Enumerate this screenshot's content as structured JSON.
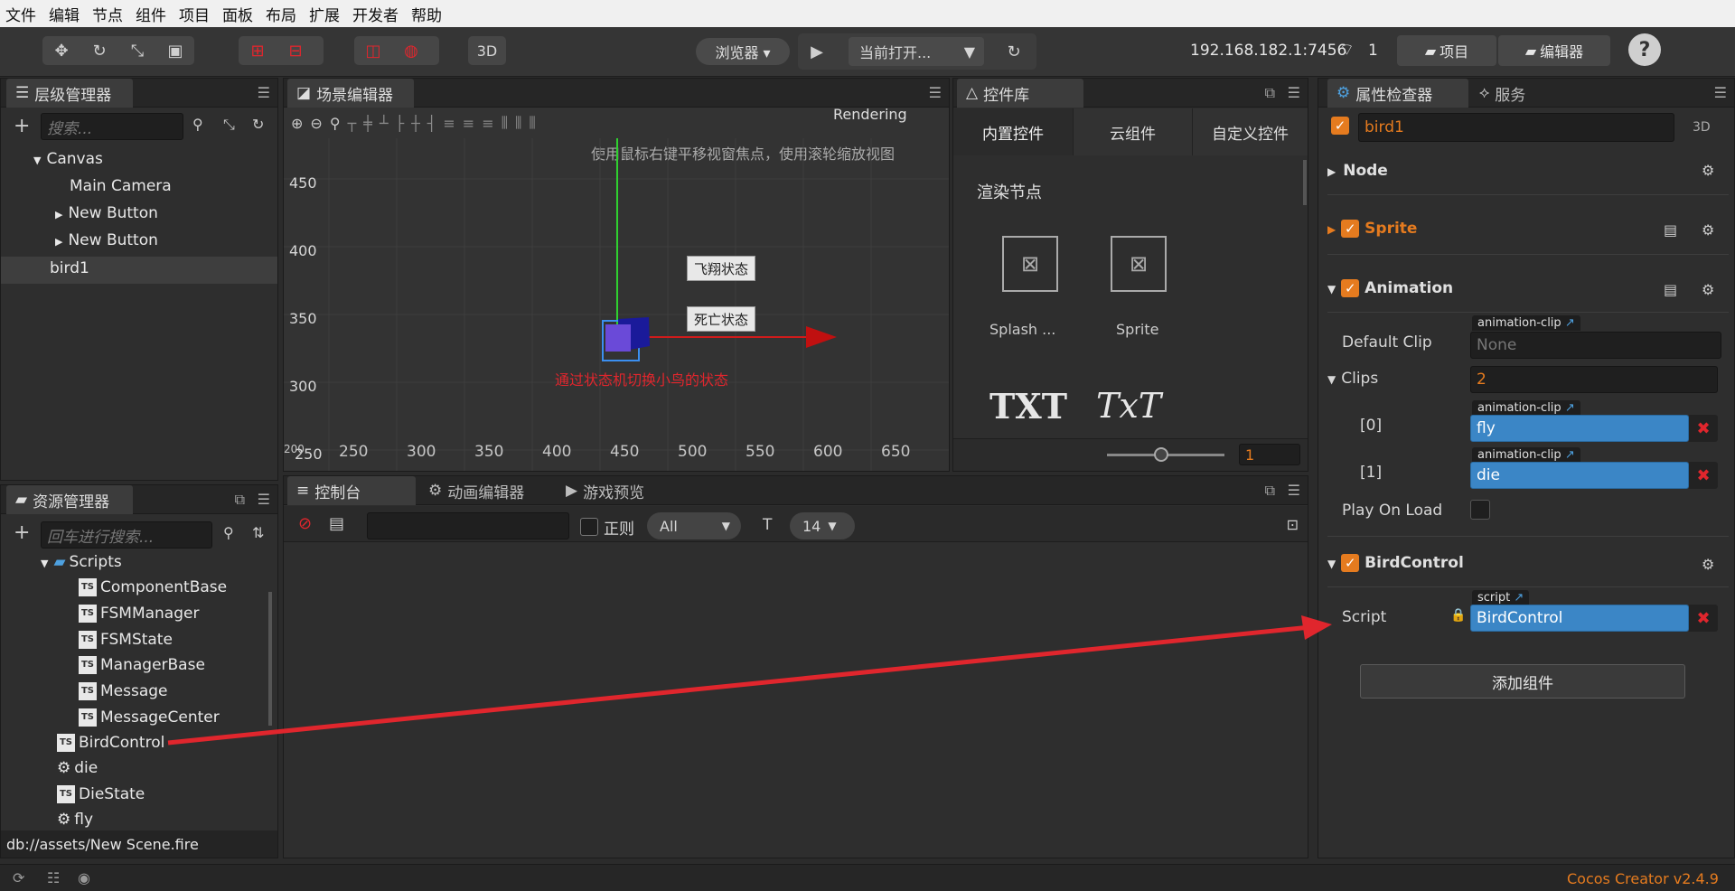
{
  "menu": [
    "文件",
    "编辑",
    "节点",
    "组件",
    "项目",
    "面板",
    "布局",
    "扩展",
    "开发者",
    "帮助"
  ],
  "toolbar": {
    "mode_3d": "3D",
    "browser": "浏览器 ▾",
    "current_open": "当前打开...",
    "ip": "192.168.182.1:7456",
    "conn_count": "1",
    "project": "项目",
    "editor": "编辑器",
    "help": "?"
  },
  "hierarchy": {
    "title": "层级管理器",
    "search_placeholder": "搜索...",
    "items": [
      "Canvas",
      "Main Camera",
      "New Button",
      "New Button",
      "bird1"
    ]
  },
  "scene": {
    "title": "场景编辑器",
    "rendering": "Rendering",
    "hint": "使用鼠标右键平移视窗焦点，使用滚轮缩放视图",
    "y_ticks": [
      "450",
      "400",
      "350",
      "300",
      "250"
    ],
    "x_ticks": [
      "200",
      "250",
      "300",
      "350",
      "400",
      "450",
      "500",
      "550",
      "600",
      "650"
    ],
    "btn_fly": "飞翔状态",
    "btn_die": "死亡状态",
    "caption": "通过状态机切换小鸟的状态"
  },
  "library": {
    "title": "控件库",
    "tabs": [
      "内置控件",
      "云组件",
      "自定义控件"
    ],
    "section": "渲染节点",
    "items": [
      "Splash ...",
      "Sprite"
    ],
    "txt_items": [
      "TXT",
      "TxT"
    ],
    "zoom_value": "1"
  },
  "assets": {
    "title": "资源管理器",
    "search_placeholder": "回车进行搜索...",
    "folder": "Scripts",
    "scripts": [
      "ComponentBase",
      "FSMManager",
      "FSMState",
      "ManagerBase",
      "Message",
      "MessageCenter"
    ],
    "root_items": [
      "BirdControl",
      "die",
      "DieState",
      "fly"
    ],
    "path": "db://assets/New Scene.fire"
  },
  "bottom": {
    "tabs": [
      "控制台",
      "动画编辑器",
      "游戏预览"
    ],
    "regex_label": "正则",
    "filter": "All",
    "font_size": "14"
  },
  "inspector": {
    "tabs": [
      "属性检查器",
      "服务"
    ],
    "node_name": "bird1",
    "mode_3d": "3D",
    "node_section": "Node",
    "sprite": "Sprite",
    "animation": "Animation",
    "default_clip_label": "Default Clip",
    "default_clip_badge": "animation-clip",
    "default_clip_value": "None",
    "clips_label": "Clips",
    "clips_count": "2",
    "clip0_label": "[0]",
    "clip0_value": "fly",
    "clip1_label": "[1]",
    "clip1_value": "die",
    "play_on_load": "Play On Load",
    "birdcontrol": "BirdControl",
    "script_label": "Script",
    "script_badge": "script",
    "script_value": "BirdControl",
    "add_component": "添加组件"
  },
  "footer": {
    "version": "Cocos Creator v2.4.9"
  },
  "colors": {
    "accent": "#e57b1f",
    "blue_field": "#3b86c6",
    "red": "#e0262d"
  }
}
